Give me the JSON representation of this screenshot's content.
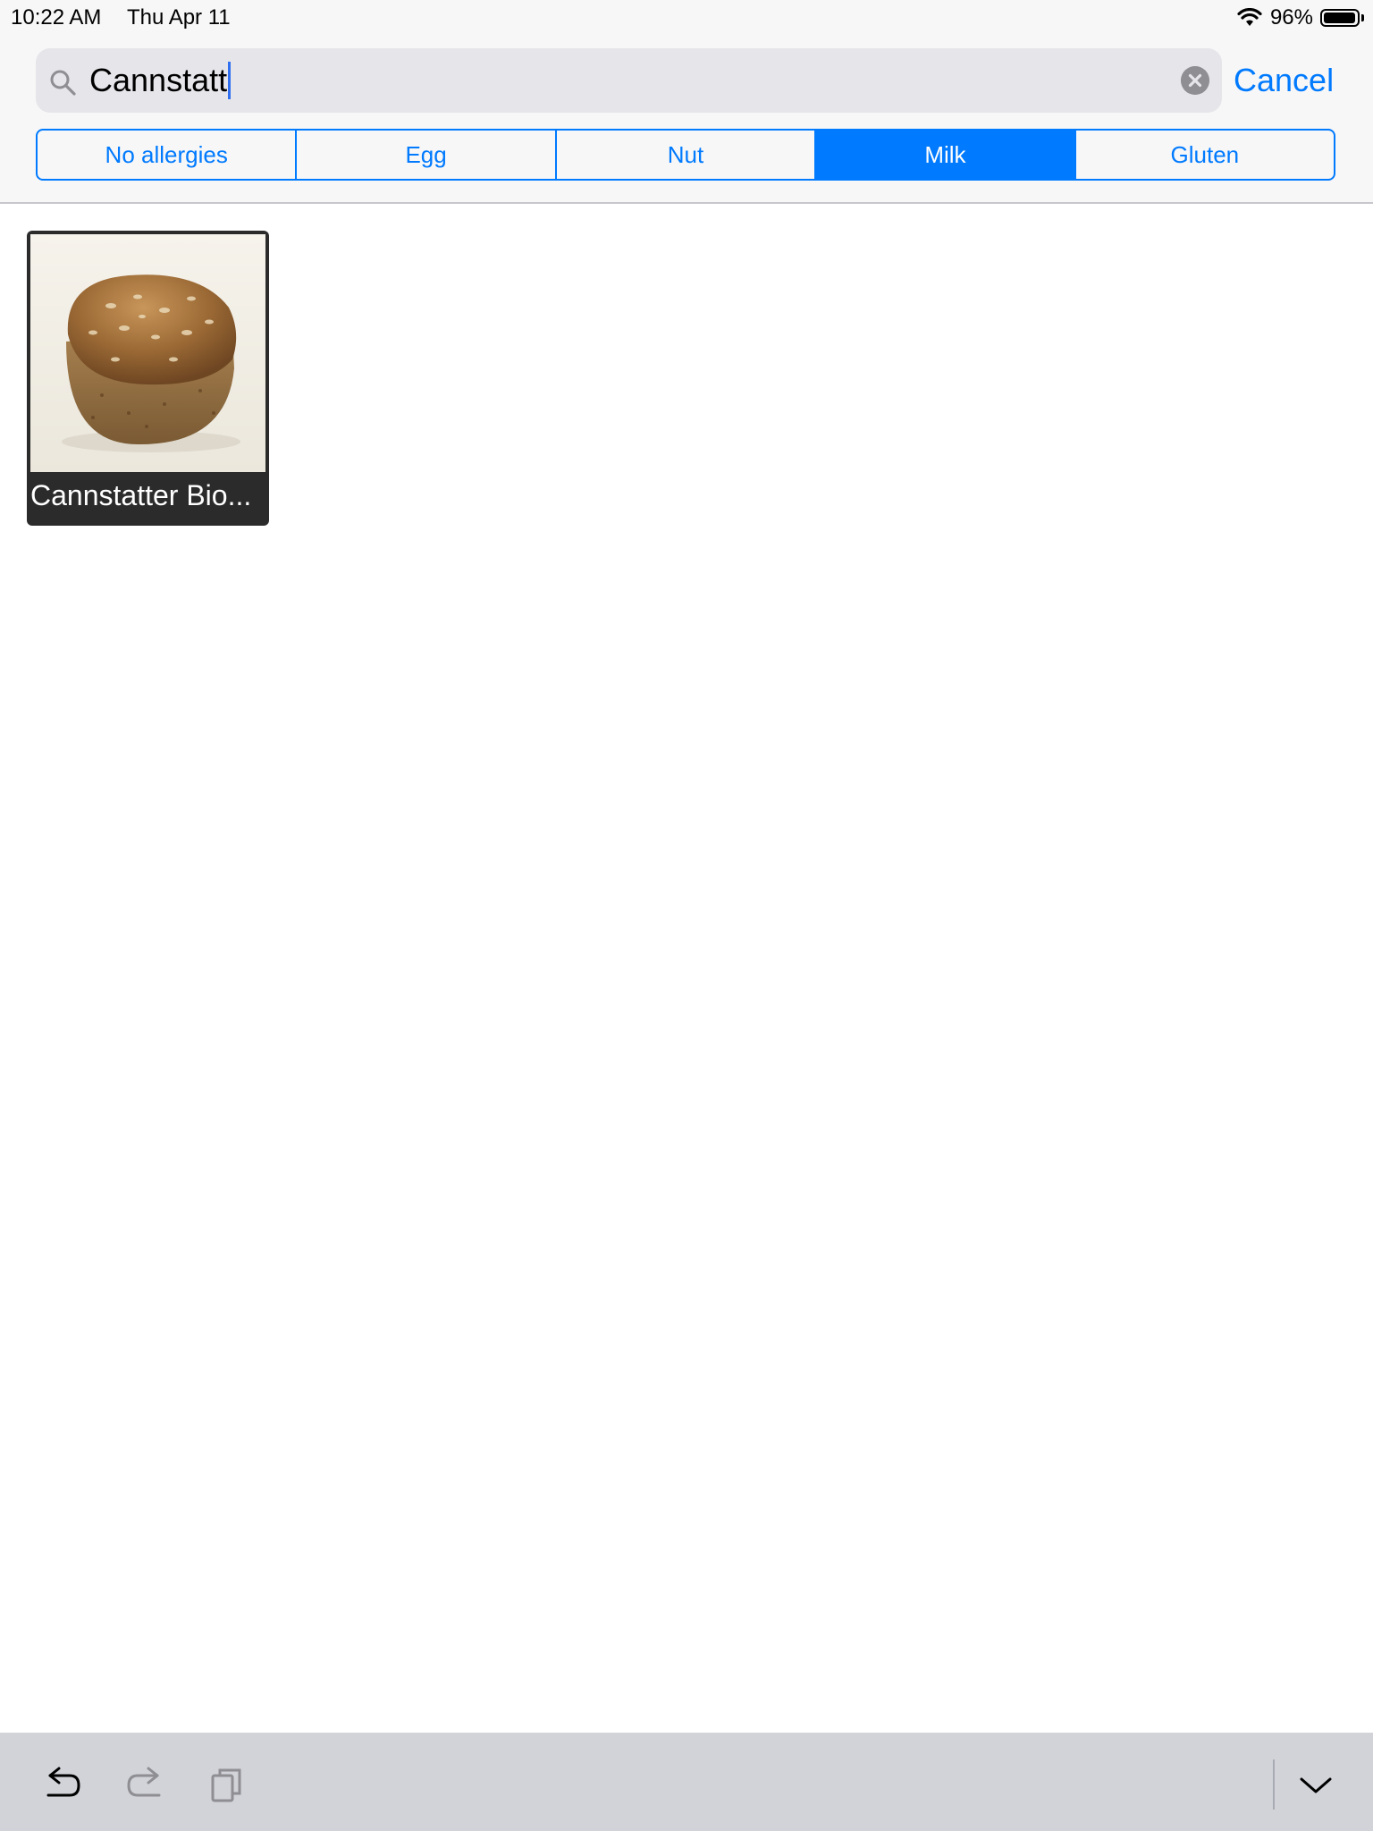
{
  "status_bar": {
    "time": "10:22 AM",
    "date": "Thu Apr 11",
    "battery_percent": "96%",
    "battery_level": 0.96,
    "icons": [
      "wifi-icon",
      "battery-icon"
    ]
  },
  "search": {
    "value": "Cannstatt",
    "cancel_label": "Cancel",
    "icons": [
      "search-icon",
      "clear-icon"
    ]
  },
  "segments": {
    "items": [
      {
        "label": "No allergies",
        "selected": false
      },
      {
        "label": "Egg",
        "selected": false
      },
      {
        "label": "Nut",
        "selected": false
      },
      {
        "label": "Milk",
        "selected": true
      },
      {
        "label": "Gluten",
        "selected": false
      }
    ]
  },
  "results": [
    {
      "label": "Cannstatter Bio..."
    }
  ],
  "keyboard_toolbar": {
    "icons": [
      "undo-icon",
      "redo-icon",
      "paste-icon",
      "chevron-down-icon"
    ]
  },
  "colors": {
    "accent": "#007aff",
    "toolbar_bg": "#d1d3d9",
    "card_bg": "#2b2b2b"
  }
}
